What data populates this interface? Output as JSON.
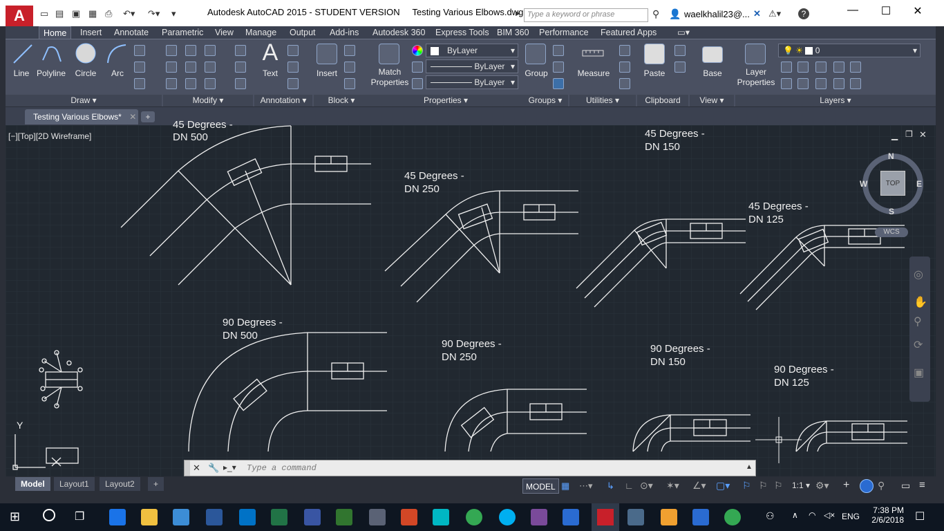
{
  "app": {
    "logo_letter": "A",
    "title": "Autodesk AutoCAD 2015 - STUDENT VERSION     Testing Various Elbows.dwg",
    "search_placeholder": "Type a keyword or phrase",
    "user": "waelkhalil23@...",
    "help": "?"
  },
  "ribbon_tabs": [
    "Home",
    "Insert",
    "Annotate",
    "Parametric",
    "View",
    "Manage",
    "Output",
    "Add-ins",
    "Autodesk 360",
    "Express Tools",
    "BIM 360",
    "Performance",
    "Featured Apps"
  ],
  "draw": {
    "line": "Line",
    "polyline": "Polyline",
    "circle": "Circle",
    "arc": "Arc",
    "panel": "Draw"
  },
  "modify": {
    "panel": "Modify"
  },
  "annotation": {
    "text": "Text",
    "panel": "Annotation"
  },
  "block": {
    "insert": "Insert",
    "panel": "Block"
  },
  "properties": {
    "match": "Match Properties",
    "color": "ByLayer",
    "linetype": "ByLayer",
    "lineweight": "ByLayer",
    "panel": "Properties"
  },
  "groups": {
    "group": "Group",
    "panel": "Groups"
  },
  "utilities": {
    "measure": "Measure",
    "panel": "Utilities"
  },
  "clipboard": {
    "paste": "Paste",
    "panel": "Clipboard"
  },
  "view": {
    "base": "Base",
    "panel": "View"
  },
  "layers": {
    "layer_props": "Layer Properties",
    "current": "0",
    "panel": "Layers"
  },
  "file_tab": "Testing Various Elbows*",
  "viewport_label": "[−][Top][2D Wireframe]",
  "viewcube": {
    "n": "N",
    "s": "S",
    "e": "E",
    "w": "W",
    "top": "TOP",
    "wcs": "WCS"
  },
  "drawing_labels": [
    "45 Degrees -",
    "DN 500",
    "45 Degrees -",
    "DN 250",
    "45 Degrees -",
    "DN 150",
    "45 Degrees -",
    "DN 125",
    "90 Degrees -",
    "DN 500",
    "90 Degrees -",
    "DN 250",
    "90 Degrees -",
    "DN 150",
    "90 Degrees -",
    "DN 125"
  ],
  "ucs_y": "Y",
  "command": {
    "placeholder": "Type a command"
  },
  "layout_tabs": [
    "Model",
    "Layout1",
    "Layout2"
  ],
  "status": {
    "model": "MODEL",
    "scale": "1:1"
  },
  "taskbar": {
    "lang": "ENG",
    "time": "7:38 PM",
    "date": "2/6/2018"
  }
}
